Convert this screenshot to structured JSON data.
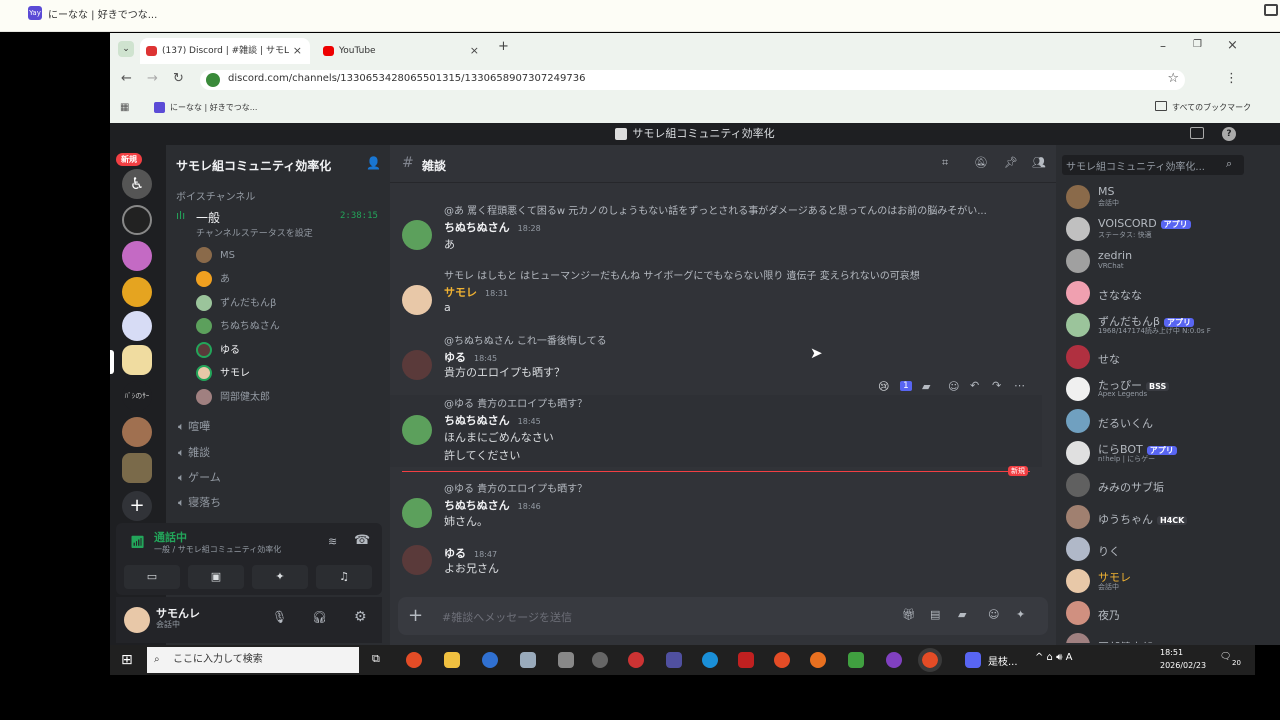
{
  "outer_tab": {
    "title": "にーなな | 好きでつな..."
  },
  "browser": {
    "tabs": [
      {
        "label": "(137) Discord | #雑談 | サモL",
        "active": true
      },
      {
        "label": "YouTube",
        "active": false
      }
    ],
    "url": "discord.com/channels/1330653428065501315/1330658907307249736",
    "bookmark": "にーなな | 好きでつな...",
    "all_bookmarks": "すべてのブックマーク"
  },
  "discord": {
    "window_title": "サモレ組コミュニティ効率化",
    "server_name": "サモレ組コミュニティ効率化",
    "new_badge": "新規",
    "voice_section": "ボイスチャンネル",
    "voice_channel": {
      "name": "一般",
      "time": "2:38:15",
      "status": "チャンネルステータスを設定"
    },
    "voice_users": [
      "MS",
      "あ",
      "ずんだもんβ",
      "ちぬちぬさん",
      "ゆる",
      "サモレ",
      "岡部健太郎"
    ],
    "channels": [
      "喧嘩",
      "雑談",
      "ゲーム",
      "寝落ち"
    ],
    "call": {
      "title": "通話中",
      "sub": "一般 / サモレ組コミュニティ効率化"
    },
    "user": {
      "name": "サモんレ",
      "status": "会話中"
    },
    "channel_header": "雑談",
    "search_placeholder": "サモレ組コミュニティ効率化...",
    "messages": [
      {
        "reply": "@あ 罵く程頭悪くて困るw 元カノのしょうもない話をずっとされる事がダメージあると思ってんのはお前の脳みそがい...",
        "author": "ちぬちぬさん",
        "time": "18:28",
        "text": [
          "あ"
        ]
      },
      {
        "reply": "サモレ はしもと はヒューマンジーだもんね サイボーグにでもならない限り 遺伝子 変えられないの可哀想",
        "author": "サモレ",
        "time": "18:31",
        "text": [
          "a"
        ]
      },
      {
        "reply": "@ちぬちぬさん これ一番後悔してる",
        "author": "ゆる",
        "time": "18:45",
        "text": [
          "貴方のエロイプも晒す？"
        ]
      },
      {
        "reply": "@ゆる 貴方のエロイプも晒す？",
        "author": "ちぬちぬさん",
        "time": "18:45",
        "text": [
          "ほんまにごめんなさい",
          "許してください"
        ]
      },
      {
        "reply": "@ゆる 貴方のエロイプも晒す？",
        "author": "ちぬちぬさん",
        "time": "18:46",
        "text": [
          "姉さん。"
        ]
      },
      {
        "reply": "",
        "author": "ゆる",
        "time": "18:47",
        "text": [
          "よお兄さん"
        ]
      }
    ],
    "new_divider": "新規",
    "reaction_count": "1",
    "composer_placeholder": "#雑談へメッセージを送信",
    "members": [
      {
        "name": "MS",
        "sub": "会話中",
        "tag": ""
      },
      {
        "name": "VOISCORD",
        "sub": "ステータス: 快適",
        "tag": "アプリ"
      },
      {
        "name": "zedrin",
        "sub": "VRChat",
        "tag": ""
      },
      {
        "name": "さななな",
        "sub": "",
        "tag": ""
      },
      {
        "name": "ずんだもんβ",
        "sub": "1968/147174読み上げ中 N:0.0s F",
        "tag": "アプリ"
      },
      {
        "name": "せな",
        "sub": "",
        "tag": ""
      },
      {
        "name": "たっぴー",
        "sub": "Apex Legends",
        "tag": "BSS"
      },
      {
        "name": "だるいくん",
        "sub": "",
        "tag": ""
      },
      {
        "name": "にらBOT",
        "sub": "n!help | にらゲー",
        "tag": "アプリ"
      },
      {
        "name": "みみのサブ垢",
        "sub": "",
        "tag": ""
      },
      {
        "name": "ゆうちゃん",
        "sub": "",
        "tag": "H4CK"
      },
      {
        "name": "りく",
        "sub": "",
        "tag": ""
      },
      {
        "name": "サモレ",
        "sub": "会話中",
        "tag": ""
      },
      {
        "name": "夜乃",
        "sub": "",
        "tag": ""
      },
      {
        "name": "岡部健太郎",
        "sub": "",
        "tag": ""
      }
    ]
  },
  "taskbar": {
    "search": "ここに入力して検索",
    "app_label": "是枝...",
    "time": "18:51",
    "date": "2026/02/23",
    "notif": "20"
  }
}
